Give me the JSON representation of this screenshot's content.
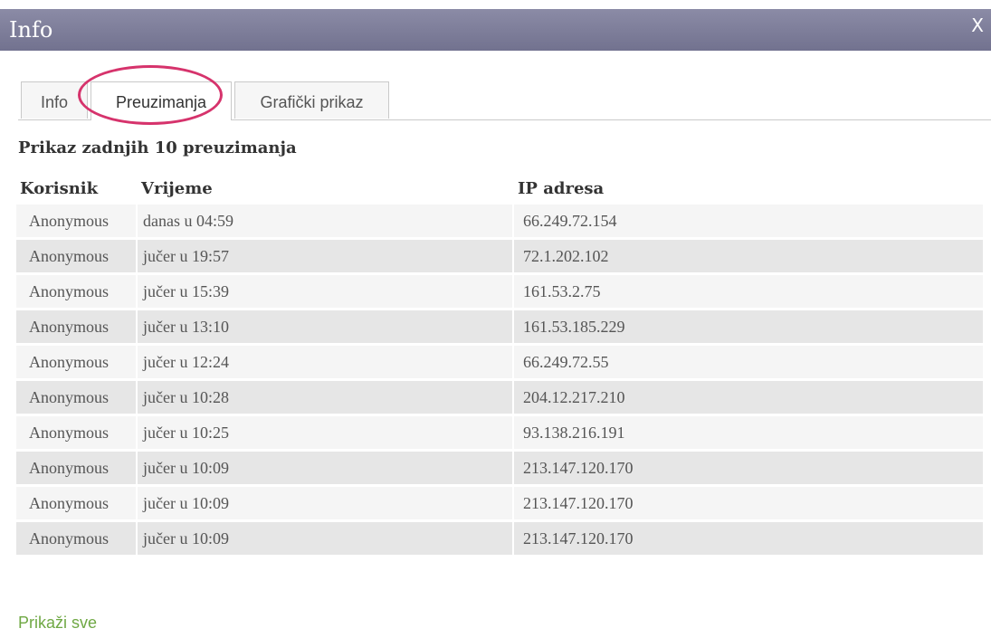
{
  "window": {
    "title": "Info",
    "close_label": "X"
  },
  "tabs": [
    {
      "label": "Info",
      "active": false
    },
    {
      "label": "Preuzimanja",
      "active": true
    },
    {
      "label": "Grafički prikaz",
      "active": false
    }
  ],
  "section_title": "Prikaz zadnjih 10 preuzimanja",
  "table": {
    "headers": [
      "Korisnik",
      "Vrijeme",
      "IP adresa"
    ],
    "rows": [
      {
        "user": "Anonymous",
        "time": "danas u 04:59",
        "ip": "66.249.72.154"
      },
      {
        "user": "Anonymous",
        "time": "jučer u 19:57",
        "ip": "72.1.202.102"
      },
      {
        "user": "Anonymous",
        "time": "jučer u 15:39",
        "ip": "161.53.2.75"
      },
      {
        "user": "Anonymous",
        "time": "jučer u 13:10",
        "ip": "161.53.185.229"
      },
      {
        "user": "Anonymous",
        "time": "jučer u 12:24",
        "ip": "66.249.72.55"
      },
      {
        "user": "Anonymous",
        "time": "jučer u 10:28",
        "ip": "204.12.217.210"
      },
      {
        "user": "Anonymous",
        "time": "jučer u 10:25",
        "ip": "93.138.216.191"
      },
      {
        "user": "Anonymous",
        "time": "jučer u 10:09",
        "ip": "213.147.120.170"
      },
      {
        "user": "Anonymous",
        "time": "jučer u 10:09",
        "ip": "213.147.120.170"
      },
      {
        "user": "Anonymous",
        "time": "jučer u 10:09",
        "ip": "213.147.120.170"
      }
    ]
  },
  "footer": {
    "show_all_label": "Prikaži sve"
  },
  "colors": {
    "titlebar": "#7d7d99",
    "row_odd": "#f5f5f5",
    "row_even": "#e6e6e6",
    "link": "#6fa844",
    "highlight": "#d6336c"
  }
}
